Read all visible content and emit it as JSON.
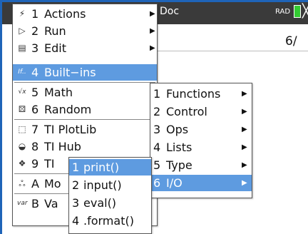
{
  "app": {
    "doc_title": "Doc",
    "angle_mode": "RAD",
    "close_glyph": "╳",
    "page_indicator": "6/"
  },
  "menu": {
    "items": [
      {
        "key": "1",
        "label": "Actions",
        "icon": "lightning-icon",
        "glyph": "⚡",
        "has_submenu": true
      },
      {
        "key": "2",
        "label": "Run",
        "icon": "play-outline-icon",
        "glyph": "▷",
        "has_submenu": true
      },
      {
        "key": "3",
        "label": "Edit",
        "icon": "edit-icon",
        "glyph": "▤",
        "has_submenu": true
      },
      {
        "key": "4",
        "label": "Built−ins",
        "icon": "if-icon",
        "glyph": "If..",
        "has_submenu": true,
        "selected": true
      },
      {
        "key": "5",
        "label": "Math",
        "icon": "sqrt-icon",
        "glyph": "√x",
        "has_submenu": false
      },
      {
        "key": "6",
        "label": "Random",
        "icon": "dice-icon",
        "glyph": "⚄",
        "has_submenu": false
      },
      {
        "key": "7",
        "label": "TI PlotLib",
        "icon": "plot-icon",
        "glyph": "⬚",
        "has_submenu": false
      },
      {
        "key": "8",
        "label": "TI Hub",
        "icon": "hub-icon",
        "glyph": "◒",
        "has_submenu": false
      },
      {
        "key": "9",
        "label": "TI",
        "icon": "rover-icon",
        "glyph": "❖",
        "has_submenu": false
      },
      {
        "key": "A",
        "label": "Mo",
        "icon": "modules-icon",
        "glyph": "ஃ",
        "has_submenu": false
      },
      {
        "key": "B",
        "label": "Va",
        "icon": "var-icon",
        "glyph": "var",
        "has_submenu": false
      }
    ]
  },
  "builtins_menu": {
    "items": [
      {
        "key": "1",
        "label": "Functions"
      },
      {
        "key": "2",
        "label": "Control"
      },
      {
        "key": "3",
        "label": "Ops"
      },
      {
        "key": "4",
        "label": "Lists"
      },
      {
        "key": "5",
        "label": "Type"
      },
      {
        "key": "6",
        "label": "I/O",
        "selected": true
      }
    ]
  },
  "io_menu": {
    "items": [
      {
        "key": "1",
        "label": "print()",
        "selected": true
      },
      {
        "key": "2",
        "label": "input()"
      },
      {
        "key": "3",
        "label": "eval()"
      },
      {
        "key": "4",
        "label": ".format()"
      }
    ]
  },
  "colors": {
    "selection": "#5e9be0",
    "window_border": "#1f64b8",
    "header": "#3a3a3a",
    "battery": "#33cc33"
  }
}
